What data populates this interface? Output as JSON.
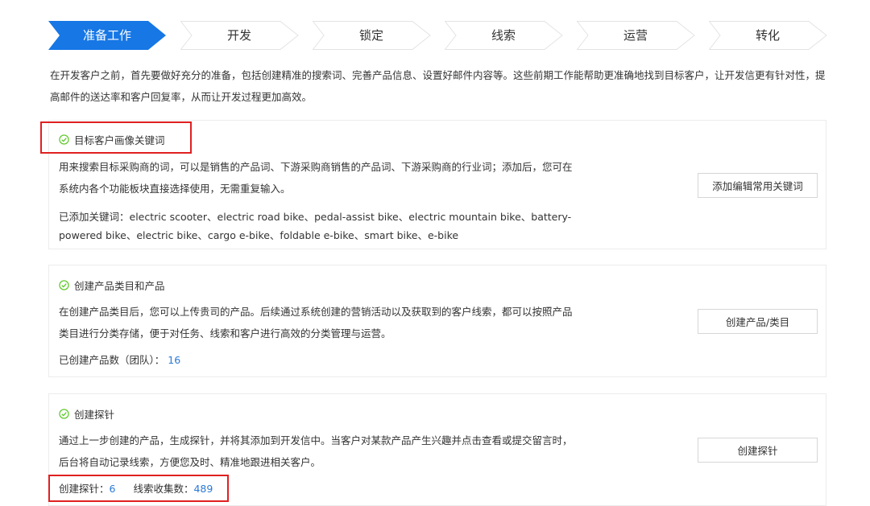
{
  "steps": [
    {
      "label": "准备工作",
      "active": true
    },
    {
      "label": "开发",
      "active": false
    },
    {
      "label": "锁定",
      "active": false
    },
    {
      "label": "线索",
      "active": false
    },
    {
      "label": "运营",
      "active": false
    },
    {
      "label": "转化",
      "active": false
    }
  ],
  "colors": {
    "accent": "#1677e5",
    "link": "#2b79d6",
    "highlight": "#e02020",
    "check": "#52c41a"
  },
  "intro": "在开发客户之前，首先要做好充分的准备，包括创建精准的搜索词、完善产品信息、设置好邮件内容等。这些前期工作能帮助更准确地找到目标客户，让开发信更有针对性，提高邮件的送达率和客户回复率，从而让开发过程更加高效。",
  "cards": {
    "keywords": {
      "title": "目标客户画像关键词",
      "desc": "用来搜索目标采购商的词，可以是销售的产品词、下游采购商销售的产品词、下游采购商的行业词；添加后，您可在系统内各个功能板块直接选择使用，无需重复输入。",
      "added_label": "已添加关键词：",
      "added_value": "electric scooter、electric road bike、pedal-assist bike、electric mountain bike、battery-powered bike、electric bike、cargo e-bike、foldable e-bike、smart bike、e-bike",
      "button": "添加编辑常用关键词"
    },
    "products": {
      "title": "创建产品类目和产品",
      "desc": "在创建产品类目后，您可以上传贵司的产品。后续通过系统创建的营销活动以及获取到的客户线索，都可以按照产品类目进行分类存储，便于对任务、线索和客户进行高效的分类管理与运营。",
      "count_label": "已创建产品数（团队）：",
      "count_value": "16",
      "button": "创建产品/类目"
    },
    "probe": {
      "title": "创建探针",
      "desc": "通过上一步创建的产品，生成探针，并将其添加到开发信中。当客户对某款产品产生兴趣并点击查看或提交留言时，后台将自动记录线索，方便您及时、精准地跟进相关客户。",
      "probe_label": "创建探针：",
      "probe_value": "6",
      "leads_label": "线索收集数：",
      "leads_value": "489",
      "button": "创建探针"
    }
  }
}
